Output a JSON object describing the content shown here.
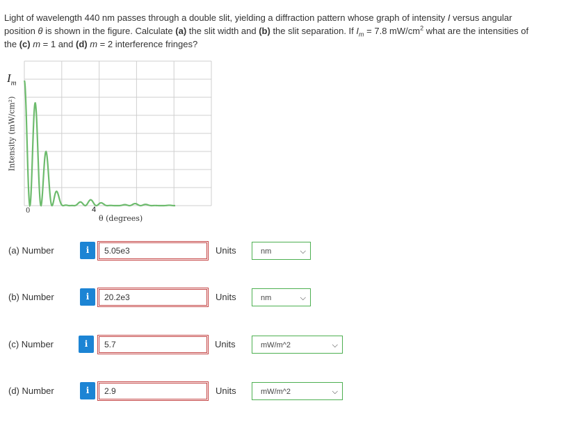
{
  "question": {
    "line1_a": "Light of wavelength 440 nm passes through a double slit, yielding a diffraction pattern whose graph of intensity ",
    "line1_I": "I",
    "line1_b": " versus angular",
    "line2_a": "position ",
    "line2_theta": "θ",
    "line2_b": " is shown in the figure. Calculate ",
    "part_a": "(a)",
    "line2_c": " the slit width and ",
    "part_b": "(b)",
    "line2_d": " the slit separation. If ",
    "im_I": "I",
    "im_sub": "m",
    "line2_e": " = 7.8 mW/cm",
    "sup2": "2",
    "line2_f": " what are the intensities of",
    "line3_a": "the ",
    "part_c": "(c)",
    "m1": " m",
    "line3_b": " = 1 and ",
    "part_d": "(d)",
    "m2": " m",
    "line3_c": " = 2 interference fringes?"
  },
  "figure": {
    "im_I": "I",
    "im_sub": "m",
    "ylabel": "Intensity (mW/cm²)",
    "zero": "0",
    "four": "4",
    "xlabel": "θ (degrees)",
    "curve_color": "#6dbb6d",
    "grid_color": "#cfcfcf"
  },
  "answers": [
    {
      "label": "(a)   Number",
      "info": "i",
      "value": "5.05e3",
      "units_label": "Units",
      "unit": "nm"
    },
    {
      "label": "(b)   Number",
      "info": "i",
      "value": "20.2e3",
      "units_label": "Units",
      "unit": "nm"
    },
    {
      "label": "(c)   Number",
      "info": "i",
      "value": "5.7",
      "units_label": "Units",
      "unit": "mW/m^2"
    },
    {
      "label": "(d)   Number",
      "info": "i",
      "value": "2.9",
      "units_label": "Units",
      "unit": "mW/m^2"
    }
  ],
  "colors": {
    "info_bg": "#1c84d4",
    "field_border": "#c44444",
    "select_border": "#4caf50"
  }
}
